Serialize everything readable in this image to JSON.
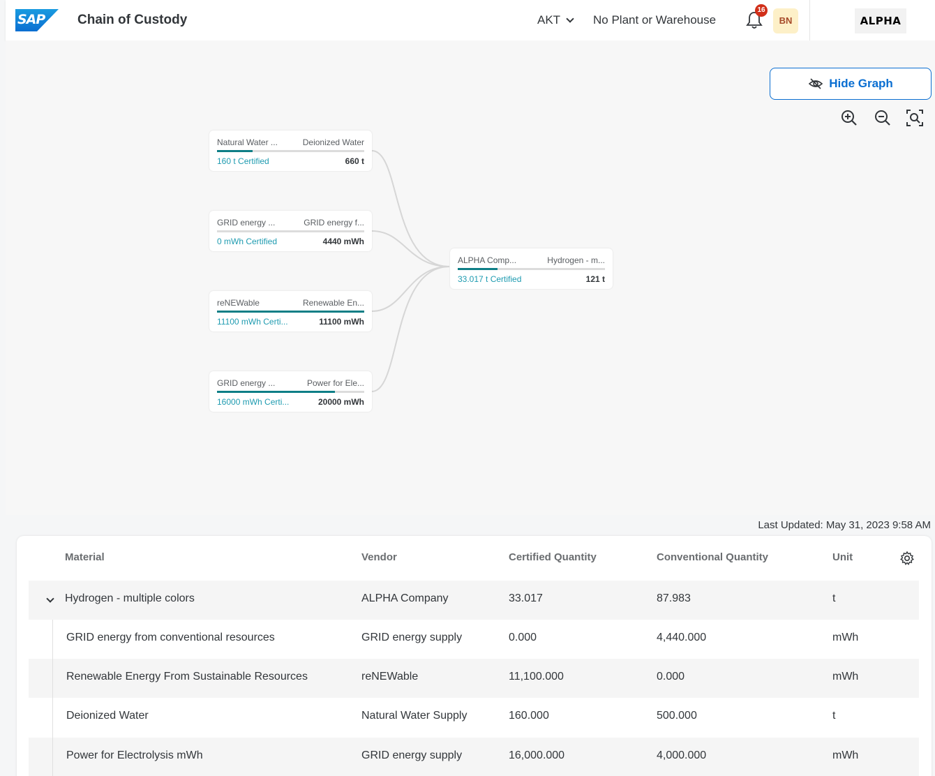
{
  "shell": {
    "logo_text": "SAP",
    "title": "Chain of Custody",
    "company": "AKT",
    "plant": "No Plant or Warehouse",
    "notification_count": "16",
    "avatar_initials": "BN",
    "brand": "ALPHA"
  },
  "graph": {
    "hide_label": "Hide Graph",
    "zoom_controls": [
      "zoom-in-icon",
      "zoom-out-icon",
      "fit-to-screen-icon"
    ],
    "nodes": [
      {
        "vendor": "Natural Water ...",
        "material": "Deionized Water",
        "certified": "160 t Certified",
        "total": "660 t",
        "certified_fraction": 0.24
      },
      {
        "vendor": "GRID energy ...",
        "material": "GRID energy f...",
        "certified": "0 mWh Certified",
        "total": "4440 mWh",
        "certified_fraction": 0.0
      },
      {
        "vendor": "reNEWable",
        "material": "Renewable En...",
        "certified": "11100 mWh Certi...",
        "total": "11100 mWh",
        "certified_fraction": 1.0
      },
      {
        "vendor": "GRID energy ...",
        "material": "Power for Ele...",
        "certified": "16000 mWh Certi...",
        "total": "20000 mWh",
        "certified_fraction": 0.8
      }
    ],
    "target": {
      "vendor": "ALPHA Comp...",
      "material": "Hydrogen - m...",
      "certified": "33.017 t Certified",
      "total": "121 t",
      "certified_fraction": 0.27
    }
  },
  "last_updated": "Last Updated: May 31, 2023 9:58 AM",
  "table": {
    "columns": [
      "Material",
      "Vendor",
      "Certified Quantity",
      "Conventional Quantity",
      "Unit"
    ],
    "rows": [
      {
        "material": "Hydrogen - multiple colors",
        "vendor": "ALPHA Company",
        "certified": "33.017",
        "conventional": "87.983",
        "unit": "t"
      },
      {
        "material": "GRID energy from conventional resources",
        "vendor": "GRID energy supply",
        "certified": "0.000",
        "conventional": "4,440.000",
        "unit": "mWh"
      },
      {
        "material": "Renewable Energy From Sustainable Resources",
        "vendor": "reNEWable",
        "certified": "11,100.000",
        "conventional": "0.000",
        "unit": "mWh"
      },
      {
        "material": "Deionized Water",
        "vendor": "Natural Water Supply",
        "certified": "160.000",
        "conventional": "500.000",
        "unit": "t"
      },
      {
        "material": "Power for Electrolysis mWh",
        "vendor": "GRID energy supply",
        "certified": "16,000.000",
        "conventional": "4,000.000",
        "unit": "mWh"
      }
    ]
  },
  "colors": {
    "accent": "#0a6ed1",
    "certified_text": "#1e9bb0",
    "progress_fill": "#0e7e86",
    "badge": "#d12f19"
  }
}
